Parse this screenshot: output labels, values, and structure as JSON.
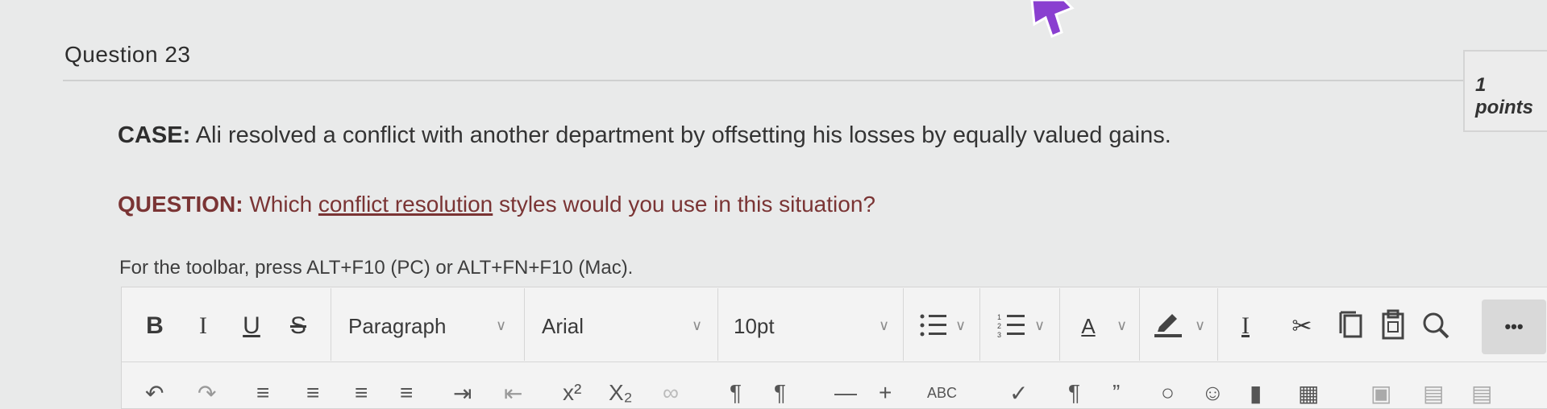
{
  "question": {
    "title": "Question 23",
    "points": "1 points",
    "case_label": "CASE:",
    "case_text": " Ali resolved a conflict with another department by offsetting his losses by equally valued gains.",
    "question_label": "QUESTION:",
    "question_pre": " Which ",
    "question_underlined": "conflict resolution",
    "question_post": " styles would you use in this situation?"
  },
  "editor": {
    "toolbar_hint": "For the toolbar, press ALT+F10 (PC) or ALT+FN+F10 (Mac).",
    "bold": "B",
    "italic": "I",
    "underline": "U",
    "strike": "S",
    "block_format": "Paragraph",
    "font_family": "Arial",
    "font_size": "10pt",
    "text_color_label": "A",
    "more_label": "•••",
    "superscript": "x²",
    "subscript": "X₂"
  },
  "colors": {
    "accent_question": "#7a3434",
    "toolbar_bg": "#f3f3f3",
    "page_bg": "#e9eaea"
  }
}
